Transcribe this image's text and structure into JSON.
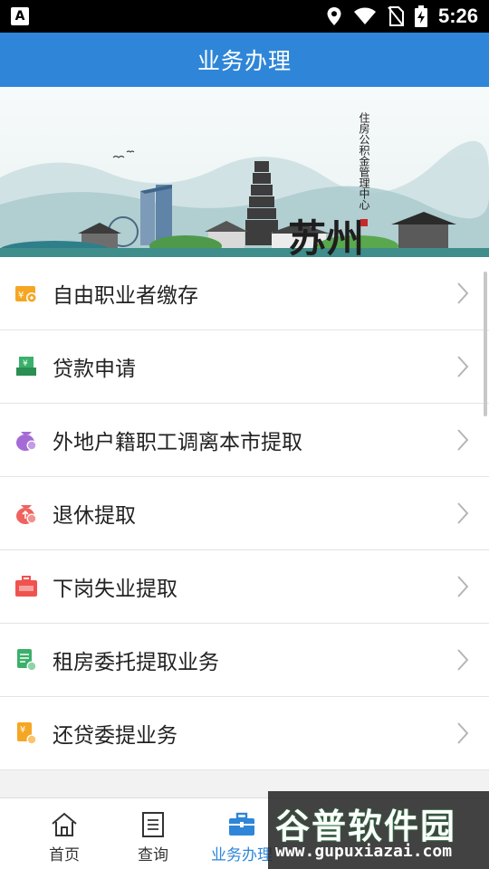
{
  "status_bar": {
    "time": "5:26",
    "left_icon": "A"
  },
  "header": {
    "title": "业务办理"
  },
  "banner": {
    "calligraphy": "苏州",
    "vertical_text": "住房公积金管理中心"
  },
  "menu": [
    {
      "label": "自由职业者缴存",
      "icon": "wallet-icon",
      "color": "#f5a623"
    },
    {
      "label": "贷款申请",
      "icon": "loan-icon",
      "color": "#3ab06a"
    },
    {
      "label": "外地户籍职工调离本市提取",
      "icon": "purple-bag-icon",
      "color": "#a46bd6"
    },
    {
      "label": "退休提取",
      "icon": "red-bag-icon",
      "color": "#f0625e"
    },
    {
      "label": "下岗失业提取",
      "icon": "briefcase-red-icon",
      "color": "#ef5350"
    },
    {
      "label": "租房委托提取业务",
      "icon": "document-green-icon",
      "color": "#3ab06a"
    },
    {
      "label": "还贷委提业务",
      "icon": "repay-icon",
      "color": "#f5a623"
    }
  ],
  "nav": [
    {
      "label": "首页",
      "icon": "home-icon"
    },
    {
      "label": "查询",
      "icon": "document-icon"
    },
    {
      "label": "业务办理",
      "icon": "briefcase-icon",
      "active": true
    }
  ],
  "watermark": {
    "title": "谷普软件园",
    "url": "www.gupuxiazai.com"
  },
  "colors": {
    "primary": "#2f86d8"
  }
}
